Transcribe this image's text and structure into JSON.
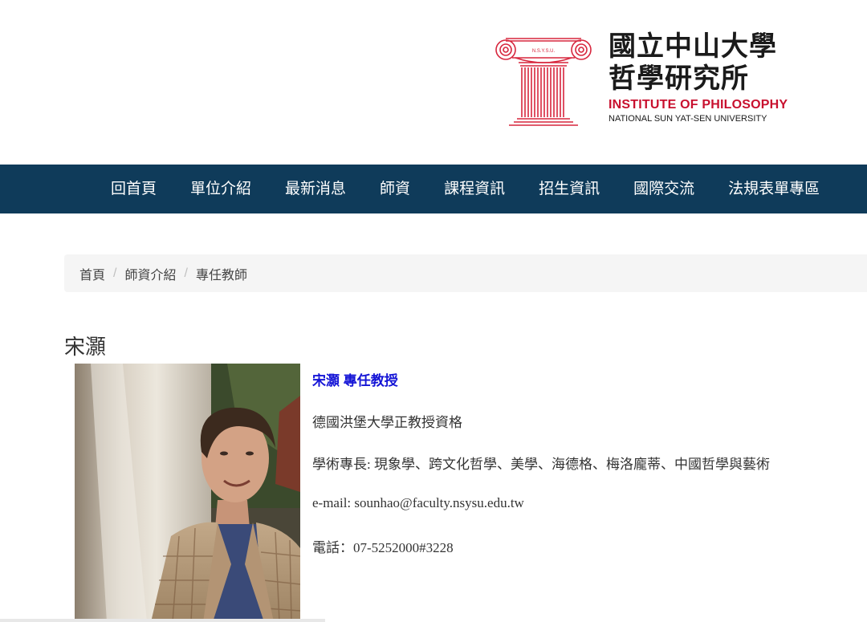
{
  "header": {
    "logo": {
      "emblem_icon": "ionic-column-emblem-icon",
      "emblem_text": "N.S.Y.S.U.",
      "name_zh_line1": "國立中山大學",
      "name_zh_line2": "哲學研究所",
      "name_en_line1": "INSTITUTE OF PHILOSOPHY",
      "name_en_line2": "NATIONAL SUN YAT-SEN UNIVERSITY",
      "brand_red": "#c8102e"
    }
  },
  "nav": {
    "background": "#0f3b5a",
    "items": [
      {
        "label": "回首頁"
      },
      {
        "label": "單位介紹"
      },
      {
        "label": "最新消息"
      },
      {
        "label": "師資"
      },
      {
        "label": "課程資訊"
      },
      {
        "label": "招生資訊"
      },
      {
        "label": "國際交流"
      },
      {
        "label": "法規表單專區"
      }
    ]
  },
  "breadcrumb": {
    "items": [
      {
        "label": "首頁"
      },
      {
        "label": "師資介紹"
      },
      {
        "label": "專任教師"
      }
    ],
    "separator": "/"
  },
  "page": {
    "title": "宋灝"
  },
  "profile": {
    "photo_icon": "faculty-portrait-photo",
    "name_title": "宋灝 專任教授",
    "name_color": "#1515d6",
    "qualification": "德國洪堡大學正教授資格",
    "expertise": "學術專長: 現象學、跨文化哲學、美學、海德格、梅洛龐蒂、中國哲學與藝術",
    "email": "e-mail: sounhao@faculty.nsysu.edu.tw",
    "phone": "電話：07-5252000#3228"
  }
}
